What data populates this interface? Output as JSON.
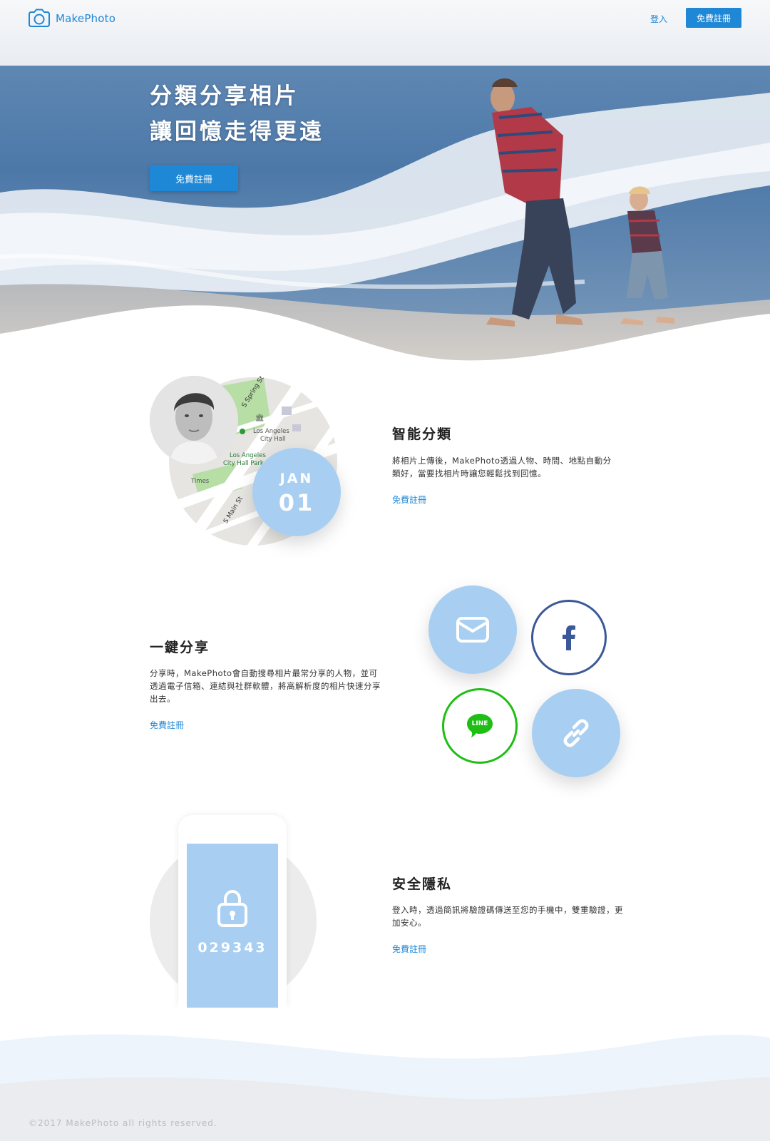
{
  "header": {
    "logo_text": "MakePhoto",
    "login_label": "登入",
    "signup_label": "免費註冊"
  },
  "hero": {
    "title_line1": "分類分享相片",
    "title_line2": "讓回憶走得更遠",
    "cta_label": "免費註冊"
  },
  "features": [
    {
      "title": "智能分類",
      "description": "將相片上傳後，MakePhoto透過人物、時間、地點自動分類好，當要找相片時讓您輕鬆找到回憶。",
      "link_label": "免費註冊",
      "illustration": {
        "month": "JAN",
        "day": "01",
        "map_labels": [
          "S Spring St",
          "Los Angeles\nCity Hall",
          "Los Angeles\nCity Hall Park",
          "Times",
          "S Main St",
          "S"
        ]
      }
    },
    {
      "title": "一鍵分享",
      "description": "分享時，MakePhoto會自動搜尋相片最常分享的人物，並可透過電子信箱、連結與社群軟體，將高解析度的相片快速分享出去。",
      "link_label": "免費註冊",
      "illustration": {
        "icons": [
          "mail-icon",
          "facebook-icon",
          "line-icon",
          "link-icon"
        ],
        "line_text": "LINE"
      }
    },
    {
      "title": "安全隱私",
      "description": "登入時，透過簡訊將驗證碼傳送至您的手機中，雙重驗證，更加安心。",
      "link_label": "免費註冊",
      "illustration": {
        "code": "029343",
        "icon": "lock-icon"
      }
    }
  ],
  "footer": {
    "copyright": "©2017 MakePhoto all rights reserved."
  },
  "colors": {
    "brand": "#1e88d6",
    "light_blue": "#a8cff2",
    "facebook": "#3b5998",
    "line": "#1fbe15"
  }
}
